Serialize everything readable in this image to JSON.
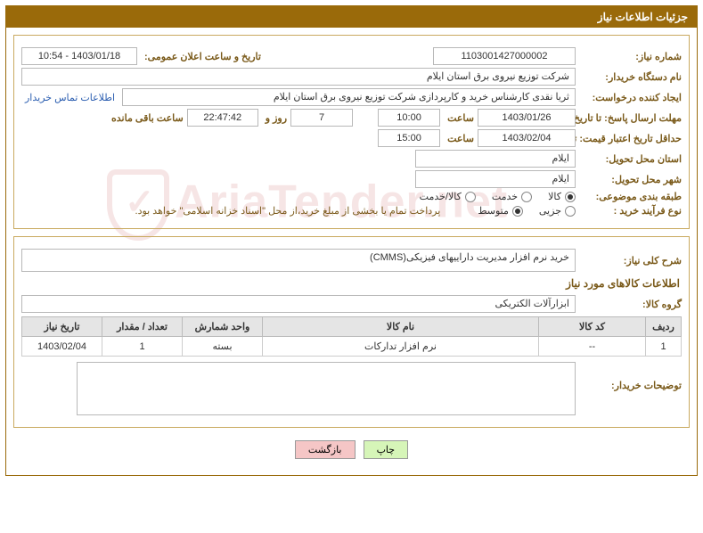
{
  "panel_title": "جزئیات اطلاعات نیاز",
  "labels": {
    "need_number": "شماره نیاز:",
    "announce_datetime": "تاریخ و ساعت اعلان عمومی:",
    "buyer_org": "نام دستگاه خریدار:",
    "creator": "ایجاد کننده درخواست:",
    "contact_link": "اطلاعات تماس خریدار",
    "response_deadline": "مهلت ارسال پاسخ: تا تاریخ:",
    "hour": "ساعت",
    "days_and": "روز و",
    "time_remaining": "ساعت باقی مانده",
    "price_validity": "حداقل تاریخ اعتبار قیمت: تا تاریخ:",
    "delivery_province": "استان محل تحویل:",
    "delivery_city": "شهر محل تحویل:",
    "category": "طبقه بندی موضوعی:",
    "purchase_process": "نوع فرآیند خرید :",
    "payment_note": "پرداخت تمام یا بخشی از مبلغ خرید،از محل \"اسناد خزانه اسلامی\" خواهد بود.",
    "general_desc": "شرح کلی نیاز:",
    "goods_info_title": "اطلاعات کالاهای مورد نیاز",
    "goods_group": "گروه کالا:",
    "buyer_notes": "توضیحات خریدار:"
  },
  "values": {
    "need_number": "1103001427000002",
    "announce_datetime": "1403/01/18 - 10:54",
    "buyer_org": "شرکت توزیع نیروی برق استان ایلام",
    "creator": "ثریا نقدی کارشناس خرید و کارپردازی شرکت توزیع نیروی برق استان ایلام",
    "response_date": "1403/01/26",
    "response_time": "10:00",
    "days_remaining": "7",
    "countdown": "22:47:42",
    "price_validity_date": "1403/02/04",
    "price_validity_time": "15:00",
    "delivery_province": "ایلام",
    "delivery_city": "ایلام",
    "general_desc": "خرید نرم افزار مدیریت داراییهای فیزیکی(CMMS)",
    "goods_group": "ابزارآلات الکتریکی"
  },
  "category_options": {
    "goods": "کالا",
    "service": "خدمت",
    "goods_service": "کالا/خدمت"
  },
  "process_options": {
    "partial": "جزیی",
    "medium": "متوسط"
  },
  "table": {
    "headers": {
      "row": "ردیف",
      "code": "کد کالا",
      "name": "نام کالا",
      "unit": "واحد شمارش",
      "qty": "تعداد / مقدار",
      "date": "تاریخ نیاز"
    },
    "rows": [
      {
        "row": "1",
        "code": "--",
        "name": "نرم افزار تدارکات",
        "unit": "بسته",
        "qty": "1",
        "date": "1403/02/04"
      }
    ]
  },
  "buttons": {
    "print": "چاپ",
    "back": "بازگشت"
  },
  "watermark": "AriaTender.net"
}
